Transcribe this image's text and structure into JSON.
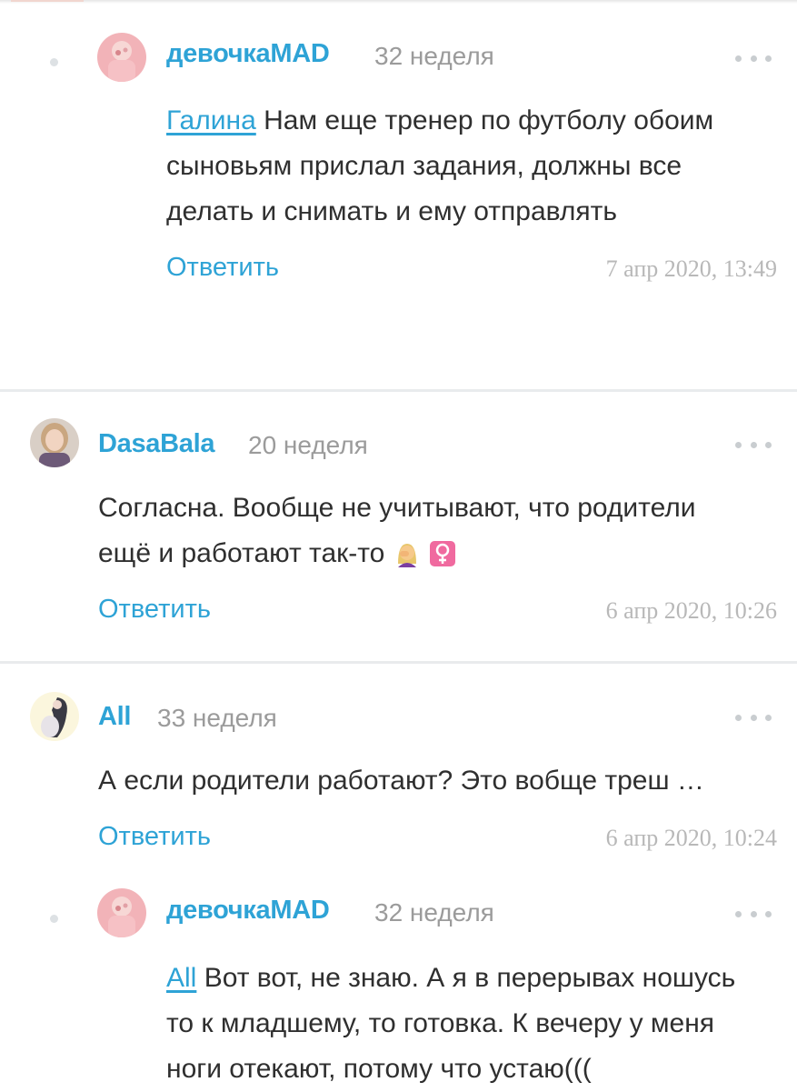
{
  "comments": [
    {
      "author": "девочкаMAD",
      "week": "32 неделя",
      "mention": "Галина",
      "lines": [
        "Нам еще тренер по футболу обоим",
        "сыновьям прислал задания, должны все",
        "делать и снимать и ему отправлять"
      ],
      "reply": "Ответить",
      "date": "7 апр 2020, 13:49"
    },
    {
      "author": "DasaBala",
      "week": "20 неделя",
      "lines": [
        "Согласна. Вообще не учитывают, что родители",
        "ещё и работают так-то"
      ],
      "emoji": [
        "woman-facepalming",
        "female-sign"
      ],
      "reply": "Ответить",
      "date": "6 апр 2020, 10:26"
    },
    {
      "author": "All",
      "week": "33 неделя",
      "lines": [
        "А если родители работают? Это вобще треш …"
      ],
      "reply": "Ответить",
      "date": "6 апр 2020, 10:24"
    },
    {
      "author": "девочкаMAD",
      "week": "32 неделя",
      "mention": "All",
      "lines": [
        "Вот вот, не знаю. А я в перерывах ношусь",
        "то к младшему, то готовка. К вечеру у меня",
        "ноги отекают, потому что устаю((("
      ]
    }
  ],
  "colors": {
    "accent": "#2ea3d6",
    "muted": "#9b9b9b",
    "divider": "#e9ebed",
    "female_sign_bg": "#f06a9f"
  }
}
